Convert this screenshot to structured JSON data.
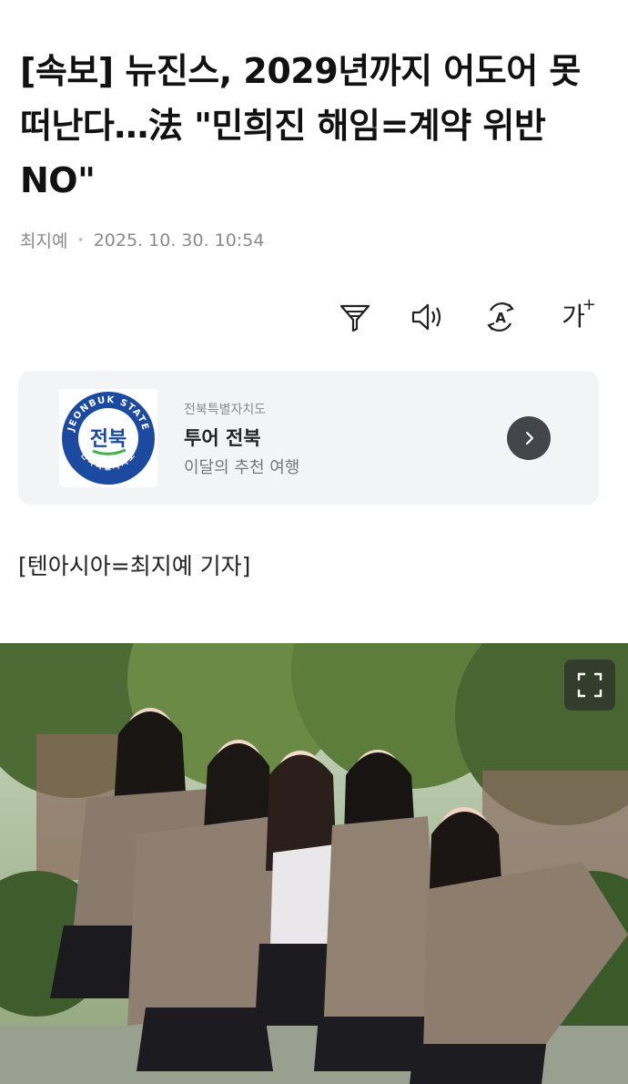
{
  "article": {
    "headline": "[속보] 뉴진스, 2029년까지 어도어 못 떠난다…法 \"민희진 해임=계약 위반 NO\"",
    "author": "최지예",
    "timestamp": "2025. 10. 30. 10:54",
    "byline": "[텐아시아=최지예 기자]"
  },
  "toolbar": {
    "icons": [
      "filter-icon",
      "speaker-icon",
      "translate-icon",
      "font-size-icon"
    ],
    "font_size_label": "가",
    "font_size_plus": "+"
  },
  "promo": {
    "logo_text_ring": "JEONBUK STATE",
    "logo_text_center": "전북",
    "logo_text_bottom": "전북특별자치도",
    "small_label": "전북특별자치도",
    "title": "투어 전북",
    "subtitle": "이달의 추천 여행",
    "colors": {
      "logo_blue": "#1c4aa0",
      "logo_green": "#3fb34a"
    }
  },
  "photo": {
    "expand_icon": "expand-icon"
  }
}
